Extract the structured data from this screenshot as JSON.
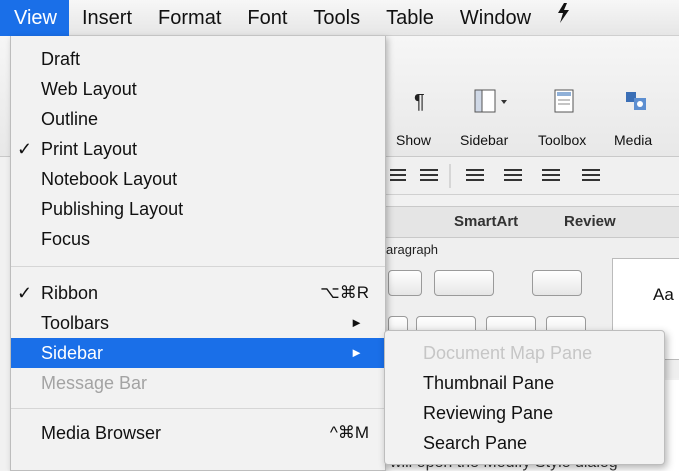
{
  "menubar": {
    "items": [
      "View",
      "Insert",
      "Format",
      "Font",
      "Tools",
      "Table",
      "Window"
    ]
  },
  "background": {
    "toolbar": {
      "show": "Show",
      "sidebar": "Sidebar",
      "toolbox": "Toolbox",
      "media": "Media"
    },
    "tabs": {
      "smartart": "SmartArt",
      "review": "Review"
    },
    "paragraph_label": "aragraph",
    "styles_preview": "Aa",
    "doc_snippet": "will open the Modify Style dialog"
  },
  "view_menu": {
    "items": [
      {
        "label": "Draft",
        "checked": false
      },
      {
        "label": "Web Layout",
        "checked": false
      },
      {
        "label": "Outline",
        "checked": false
      },
      {
        "label": "Print Layout",
        "checked": true
      },
      {
        "label": "Notebook Layout",
        "checked": false
      },
      {
        "label": "Publishing Layout",
        "checked": false
      },
      {
        "label": "Focus",
        "checked": false
      }
    ],
    "ribbon": {
      "label": "Ribbon",
      "check": "✓",
      "shortcut": "⌥⌘R"
    },
    "toolbars": {
      "label": "Toolbars",
      "arrow": "►"
    },
    "sidebar": {
      "label": "Sidebar",
      "arrow": "►"
    },
    "message_bar": {
      "label": "Message Bar"
    },
    "media_browser": {
      "label": "Media Browser",
      "shortcut": "^⌘M"
    },
    "check_glyph": "✓"
  },
  "sidebar_submenu": {
    "items": [
      {
        "label": "Document Map Pane",
        "enabled": false
      },
      {
        "label": "Thumbnail Pane",
        "enabled": true
      },
      {
        "label": "Reviewing Pane",
        "enabled": true
      },
      {
        "label": "Search Pane",
        "enabled": true
      }
    ]
  },
  "colors": {
    "highlight": "#1a6fe8",
    "menu_bg": "#f2f2f2",
    "disabled_text": "#a3a3a3"
  }
}
